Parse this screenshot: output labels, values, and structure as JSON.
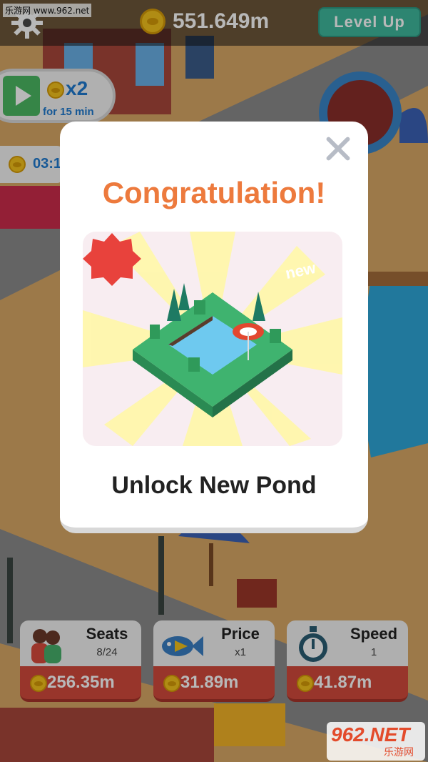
{
  "watermark": {
    "top": "乐游网 www.962.net",
    "logo": "962.NET",
    "logo_sub": "乐游网"
  },
  "hud": {
    "money": "551.649m",
    "level_up_label": "Level  Up",
    "settings_icon": "gear-icon"
  },
  "boost": {
    "multiplier": "x2",
    "duration": "for 15 min"
  },
  "timer": {
    "text": "03:1"
  },
  "modal": {
    "title": "Congratulation!",
    "badge": "new",
    "subtitle": "Unlock New Pond"
  },
  "stats": [
    {
      "label": "Seats",
      "sub": "8/24",
      "value": "256.35m",
      "icon": "people-icon"
    },
    {
      "label": "Price",
      "sub": "x1",
      "value": "31.89m",
      "icon": "fish-icon"
    },
    {
      "label": "Speed",
      "sub": "1",
      "value": "41.87m",
      "icon": "stopwatch-icon"
    }
  ],
  "colors": {
    "title": "#ed7a3d",
    "level_up": "#3fb99d",
    "stat_bottom": "#d34a3c",
    "boost_text": "#1f7bd0"
  }
}
